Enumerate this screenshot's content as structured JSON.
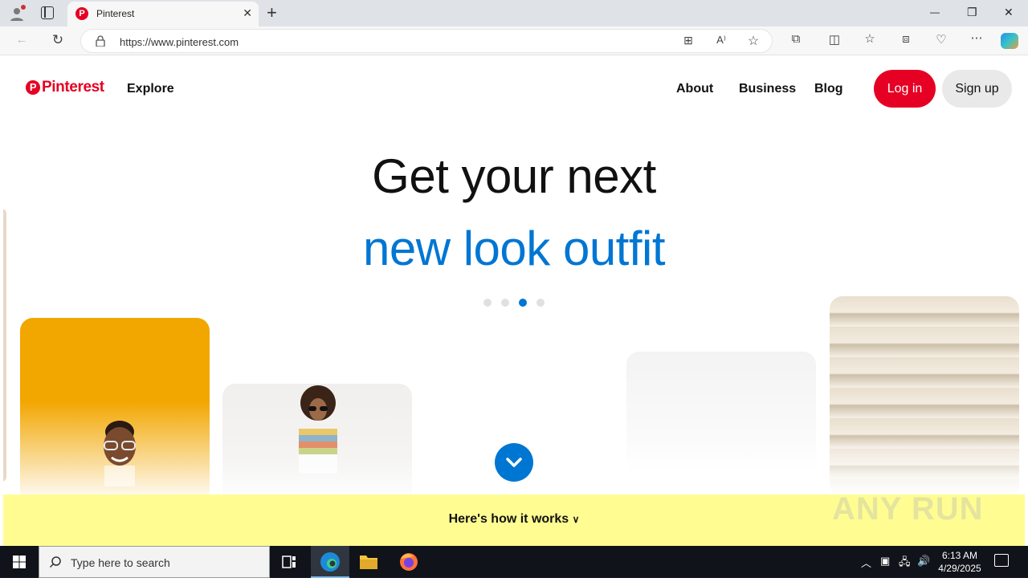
{
  "browser": {
    "tab_title": "Pinterest",
    "url": "https://www.pinterest.com",
    "new_tab": "+"
  },
  "window_controls": {
    "minimize": "—",
    "restore": "❐",
    "close": "✕"
  },
  "site": {
    "logo": "Pinterest",
    "explore": "Explore",
    "nav": [
      "About",
      "Business",
      "Blog"
    ],
    "login": "Log in",
    "signup": "Sign up",
    "headline_line1": "Get your next",
    "headline_line2": "new look outfit",
    "carousel_total": 4,
    "carousel_active": 3,
    "how_it_works": "Here's how it works",
    "accent_color": "#0076d3",
    "brand_color": "#e60023",
    "banner_color": "#fffd92"
  },
  "watermark": "ANY RUN",
  "taskbar": {
    "search_placeholder": "Type here to search",
    "time": "6:13 AM",
    "date": "4/29/2025"
  }
}
